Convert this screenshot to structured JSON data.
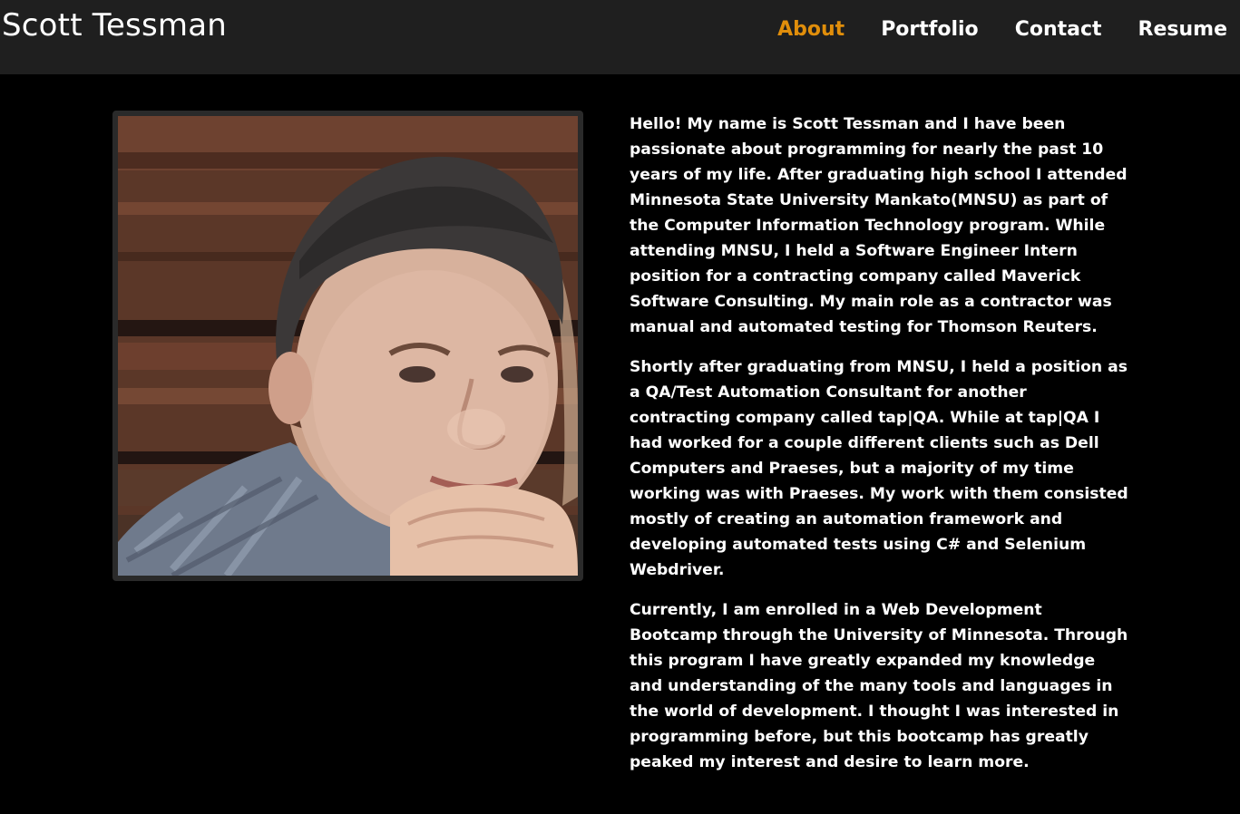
{
  "header": {
    "brand": "Scott Tessman",
    "nav": [
      {
        "label": "About",
        "active": true
      },
      {
        "label": "Portfolio",
        "active": false
      },
      {
        "label": "Contact",
        "active": false
      },
      {
        "label": "Resume",
        "active": false
      }
    ]
  },
  "about": {
    "photo_alt": "Photo of Scott Tessman",
    "paragraphs": [
      "Hello! My name is Scott Tessman and I have been passionate about programming for nearly the past 10 years of my life. After graduating high school I attended Minnesota State University Mankato(MNSU) as part of the Computer Information Technology program. While attending MNSU, I held a Software Engineer Intern position for a contracting company called Maverick Software Consulting. My main role as a contractor was manual and automated testing for Thomson Reuters.",
      "Shortly after graduating from MNSU, I held a position as a QA/Test Automation Consultant for another contracting company called tap|QA. While at tap|QA I had worked for a couple different clients such as Dell Computers and Praeses, but a majority of my time working was with Praeses. My work with them consisted mostly of creating an automation framework and developing automated tests using C# and Selenium Webdriver.",
      "Currently, I am enrolled in a Web Development Bootcamp through the University of Minnesota. Through this program I have greatly expanded my knowledge and understanding of the many tools and languages in the world of development. I thought I was interested in programming before, but this bootcamp has greatly peaked my interest and desire to learn more."
    ]
  },
  "colors": {
    "navbar_bg": "#1f1f1f",
    "page_bg": "#000000",
    "accent": "#e08e0b",
    "text": "#ffffff"
  }
}
